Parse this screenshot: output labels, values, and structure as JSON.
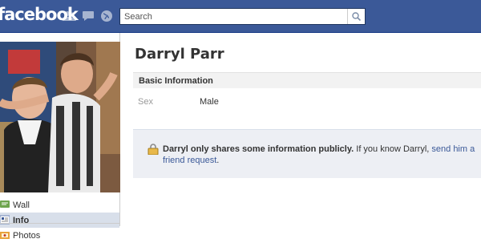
{
  "topbar": {
    "logo": "facebook",
    "jewels": [
      "friend-requests-icon",
      "messages-icon",
      "notifications-globe-icon"
    ],
    "search_placeholder": "Search",
    "search_icon": "magnifier-icon"
  },
  "sidebar": {
    "items": [
      {
        "label": "Wall",
        "icon": "wall-icon",
        "active": false
      },
      {
        "label": "Info",
        "icon": "info-icon",
        "active": true
      },
      {
        "label": "Photos",
        "icon": "photos-icon",
        "active": false
      }
    ]
  },
  "profile": {
    "name": "Darryl Parr",
    "section_title": "Basic Information",
    "fields": [
      {
        "label": "Sex",
        "value": "Male"
      }
    ],
    "notice": {
      "bold": "Darryl only shares some information publicly.",
      "text": " If you know Darryl, ",
      "link": "send him a friend request",
      "end": "."
    }
  },
  "colors": {
    "brand_blue": "#3b5998",
    "nav_active": "#d8dfea",
    "notice_bg": "#edeff4"
  }
}
